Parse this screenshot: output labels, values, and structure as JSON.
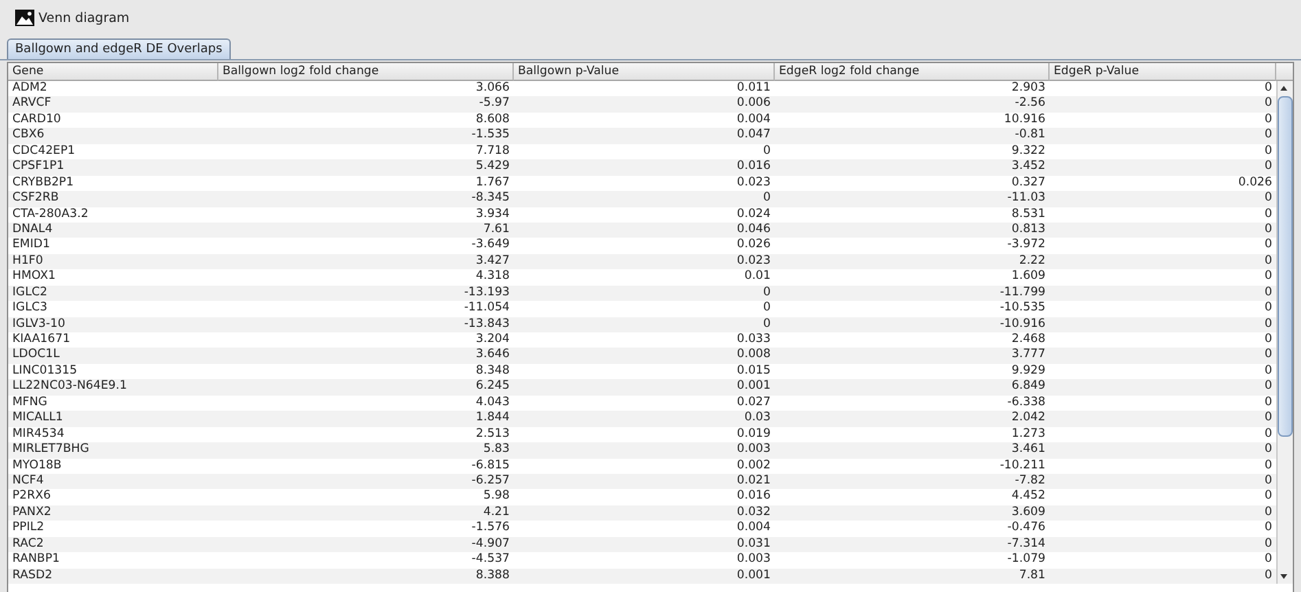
{
  "toolbar": {
    "buttons": [
      {
        "label": "Venn diagram",
        "kind": "picture"
      }
    ]
  },
  "tabs": [
    {
      "label": "Ballgown and edgeR DE Overlaps",
      "selected": true
    }
  ],
  "table": {
    "columns": [
      "Gene",
      "Ballgown log2 fold change",
      "Ballgown p-Value",
      "EdgeR log2 fold change",
      "EdgeR p-Value"
    ],
    "rows": [
      [
        "ADM2",
        "3.066",
        "0.011",
        "2.903",
        "0"
      ],
      [
        "ARVCF",
        "-5.97",
        "0.006",
        "-2.56",
        "0"
      ],
      [
        "CARD10",
        "8.608",
        "0.004",
        "10.916",
        "0"
      ],
      [
        "CBX6",
        "-1.535",
        "0.047",
        "-0.81",
        "0"
      ],
      [
        "CDC42EP1",
        "7.718",
        "0",
        "9.322",
        "0"
      ],
      [
        "CPSF1P1",
        "5.429",
        "0.016",
        "3.452",
        "0"
      ],
      [
        "CRYBB2P1",
        "1.767",
        "0.023",
        "0.327",
        "0.026"
      ],
      [
        "CSF2RB",
        "-8.345",
        "0",
        "-11.03",
        "0"
      ],
      [
        "CTA-280A3.2",
        "3.934",
        "0.024",
        "8.531",
        "0"
      ],
      [
        "DNAL4",
        "7.61",
        "0.046",
        "0.813",
        "0"
      ],
      [
        "EMID1",
        "-3.649",
        "0.026",
        "-3.972",
        "0"
      ],
      [
        "H1F0",
        "3.427",
        "0.023",
        "2.22",
        "0"
      ],
      [
        "HMOX1",
        "4.318",
        "0.01",
        "1.609",
        "0"
      ],
      [
        "IGLC2",
        "-13.193",
        "0",
        "-11.799",
        "0"
      ],
      [
        "IGLC3",
        "-11.054",
        "0",
        "-10.535",
        "0"
      ],
      [
        "IGLV3-10",
        "-13.843",
        "0",
        "-10.916",
        "0"
      ],
      [
        "KIAA1671",
        "3.204",
        "0.033",
        "2.468",
        "0"
      ],
      [
        "LDOC1L",
        "3.646",
        "0.008",
        "3.777",
        "0"
      ],
      [
        "LINC01315",
        "8.348",
        "0.015",
        "9.929",
        "0"
      ],
      [
        "LL22NC03-N64E9.1",
        "6.245",
        "0.001",
        "6.849",
        "0"
      ],
      [
        "MFNG",
        "4.043",
        "0.027",
        "-6.338",
        "0"
      ],
      [
        "MICALL1",
        "1.844",
        "0.03",
        "2.042",
        "0"
      ],
      [
        "MIR4534",
        "2.513",
        "0.019",
        "1.273",
        "0"
      ],
      [
        "MIRLET7BHG",
        "5.83",
        "0.003",
        "3.461",
        "0"
      ],
      [
        "MYO18B",
        "-6.815",
        "0.002",
        "-10.211",
        "0"
      ],
      [
        "NCF4",
        "-6.257",
        "0.021",
        "-7.82",
        "0"
      ],
      [
        "P2RX6",
        "5.98",
        "0.016",
        "4.452",
        "0"
      ],
      [
        "PANX2",
        "4.21",
        "0.032",
        "3.609",
        "0"
      ],
      [
        "PPIL2",
        "-1.576",
        "0.004",
        "-0.476",
        "0"
      ],
      [
        "RAC2",
        "-4.907",
        "0.031",
        "-7.314",
        "0"
      ],
      [
        "RANBP1",
        "-4.537",
        "0.003",
        "-1.079",
        "0"
      ],
      [
        "RASD2",
        "8.388",
        "0.001",
        "7.81",
        "0"
      ]
    ]
  }
}
